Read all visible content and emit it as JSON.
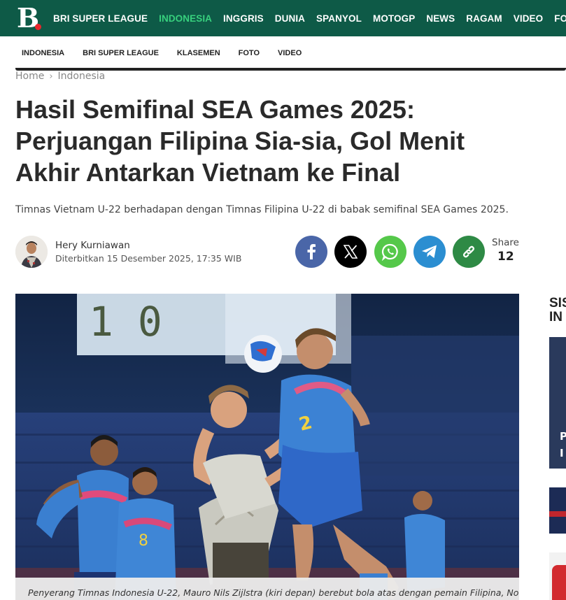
{
  "brand": {
    "logo_letter": "B"
  },
  "topnav": {
    "items": [
      {
        "label": "BRI SUPER LEAGUE",
        "active": false
      },
      {
        "label": "INDONESIA",
        "active": true
      },
      {
        "label": "INGGRIS",
        "active": false
      },
      {
        "label": "DUNIA",
        "active": false
      },
      {
        "label": "SPANYOL",
        "active": false
      },
      {
        "label": "MOTOGP",
        "active": false
      },
      {
        "label": "NEWS",
        "active": false
      },
      {
        "label": "RAGAM",
        "active": false
      },
      {
        "label": "VIDEO",
        "active": false
      },
      {
        "label": "FOTO",
        "active": false
      }
    ]
  },
  "subnav": {
    "items": [
      "INDONESIA",
      "BRI SUPER LEAGUE",
      "KLASEMEN",
      "FOTO",
      "VIDEO"
    ]
  },
  "breadcrumb": {
    "home": "Home",
    "separator": "›",
    "section": "Indonesia"
  },
  "article": {
    "title": "Hasil Semifinal SEA Games 2025: Perjuangan Filipina Sia-sia, Gol Menit Akhir Antarkan Vietnam ke Final",
    "lead": "Timnas Vietnam U-22 berhadapan dengan Timnas Filipina U-22 di babak semifinal SEA Games 2025.",
    "author": "Hery Kurniawan",
    "published": "Diterbitkan 15 Desember 2025, 17:35 WIB",
    "caption": "Penyerang Timnas Indonesia U-22, Mauro Nils Zijlstra (kiri depan) berebut bola atas dengan pemain Filipina, Noah"
  },
  "share": {
    "label": "Share",
    "count": "12",
    "buttons": [
      {
        "icon": "facebook-icon",
        "color": "#4a66a8"
      },
      {
        "icon": "x-icon",
        "color": "#000000"
      },
      {
        "icon": "whatsapp-icon",
        "color": "#55c84a"
      },
      {
        "icon": "telegram-icon",
        "color": "#2b8ed1"
      },
      {
        "icon": "link-icon",
        "color": "#2e8a45"
      }
    ]
  },
  "photo": {
    "scoreboard_text": "1  0"
  },
  "sidebar": {
    "title_line1": "SIS",
    "title_line2": "IN",
    "card_text_line1": "P",
    "card_text_line2": "I"
  },
  "colors": {
    "header_bg": "#0e5a47",
    "active_nav": "#37d07d",
    "logo_dot": "#e8262b"
  }
}
